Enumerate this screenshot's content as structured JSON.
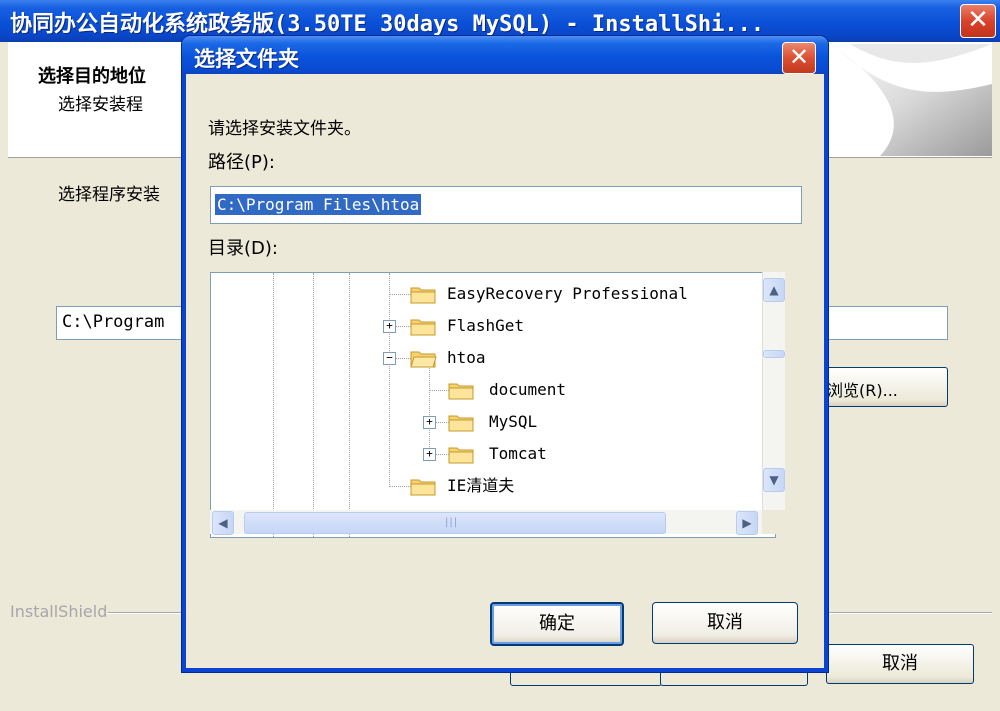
{
  "background_window": {
    "title": "协同办公自动化系统政务版(3.50TE 30days MySQL) - InstallShi...",
    "header_title": "选择目的地位",
    "header_subtitle": "选择安装程",
    "body_text": "选择程序安装",
    "path_value": "C:\\Program",
    "browse_label": "浏览(R)...",
    "installshield_label": "InstallShield",
    "cancel_label": "取消",
    "close_glyph": "✕"
  },
  "dialog": {
    "title": "选择文件夹",
    "close_glyph": "✕",
    "prompt": "请选择安装文件夹。",
    "path_label": "路径(P):",
    "path_value": "C:\\Program Files\\htoa",
    "dir_label": "目录(D):",
    "ok_label": "确定",
    "cancel_label": "取消"
  },
  "tree": {
    "items": [
      {
        "label": "EasyRecovery Professional",
        "expander": ""
      },
      {
        "label": "FlashGet",
        "expander": "+"
      },
      {
        "label": "htoa",
        "expander": "−"
      },
      {
        "label": "document",
        "expander": ""
      },
      {
        "label": "MySQL",
        "expander": "+"
      },
      {
        "label": "Tomcat",
        "expander": "+"
      },
      {
        "label": "IE清道夫",
        "expander": ""
      }
    ]
  },
  "scrollbars": {
    "up": "▲",
    "down": "▼",
    "left": "◀",
    "right": "▶",
    "grip": "|||"
  }
}
